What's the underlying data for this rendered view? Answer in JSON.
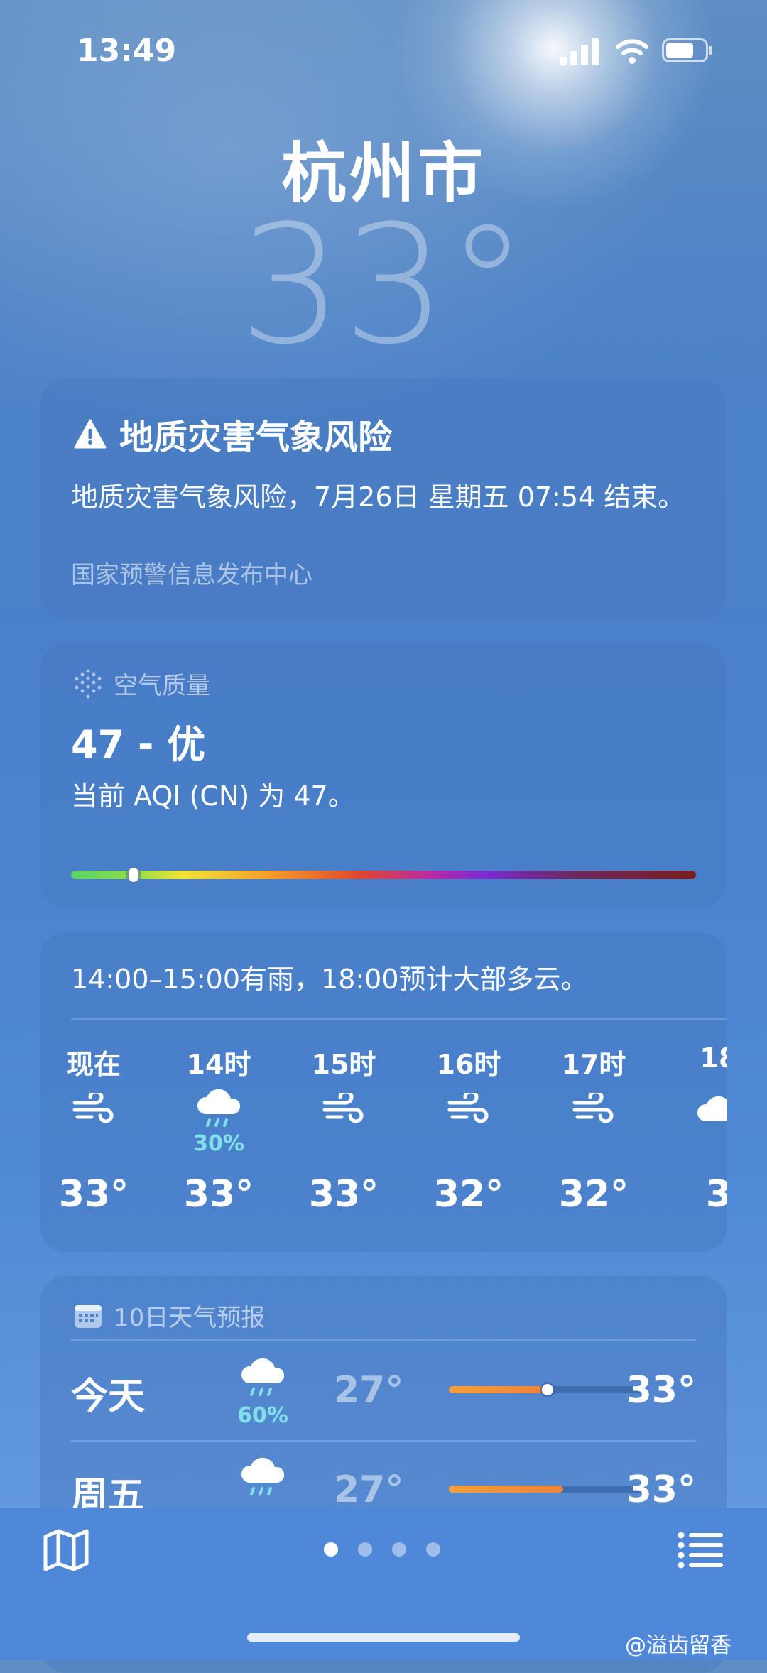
{
  "status_bar": {
    "time": "13:49"
  },
  "location": {
    "city": "杭州市",
    "current_temp": "33°"
  },
  "alert": {
    "title": "地质灾害气象风险",
    "body": "地质灾害气象风险，7月26日 星期五 07:54 结束。",
    "source": "国家预警信息发布中心"
  },
  "air_quality": {
    "label": "空气质量",
    "value": "47 - 优",
    "description": "当前 AQI (CN) 为 47。",
    "indicator_fraction": 0.1
  },
  "hourly": {
    "summary": "14:00–15:00有雨，18:00预计大部多云。",
    "items": [
      {
        "time": "现在",
        "icon": "wind-icon",
        "precip": "",
        "temp": "33°"
      },
      {
        "time": "14时",
        "icon": "rain-cloud-icon",
        "precip": "30%",
        "temp": "33°"
      },
      {
        "time": "15时",
        "icon": "wind-icon",
        "precip": "",
        "temp": "33°"
      },
      {
        "time": "16时",
        "icon": "wind-icon",
        "precip": "",
        "temp": "32°"
      },
      {
        "time": "17时",
        "icon": "wind-icon",
        "precip": "",
        "temp": "32°"
      },
      {
        "time": "18",
        "icon": "cloud-icon",
        "precip": "",
        "temp": "3"
      }
    ]
  },
  "ten_day": {
    "label": "10日天气预报",
    "days": [
      {
        "day": "今天",
        "icon": "rain-cloud-icon",
        "precip": "60%",
        "low": "27°",
        "high": "33°",
        "range_start": 0.0,
        "range_end": 0.5,
        "current": 0.5
      },
      {
        "day": "周五",
        "icon": "rain-cloud-icon",
        "precip": "",
        "low": "27°",
        "high": "33°",
        "range_start": 0.0,
        "range_end": 0.58
      }
    ]
  },
  "pagination": {
    "pages": 4,
    "active": 0
  },
  "watermark": "@溢齿留香",
  "colors": {
    "precip": "#7fe0e8",
    "temp_bar": "#f0823a",
    "bottom_bar": "#4f88d8"
  }
}
